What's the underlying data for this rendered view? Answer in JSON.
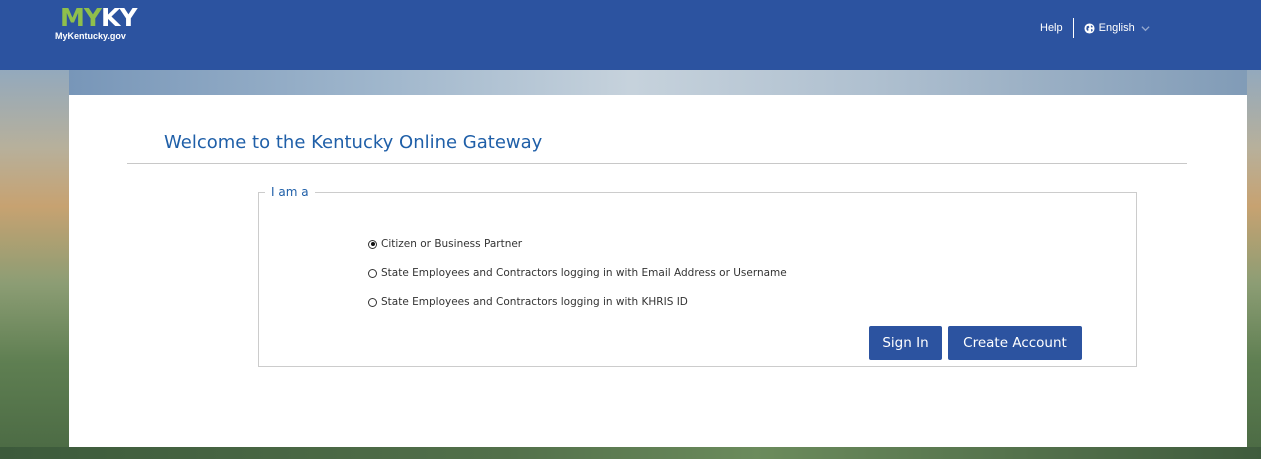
{
  "header": {
    "logo_text_my": "MY",
    "logo_text_ky": "KY",
    "logo_sub": "MyKentucky.gov",
    "help_label": "Help",
    "language_label": "English",
    "colors": {
      "bar": "#2c53a0",
      "logo_accent": "#8fbf4c"
    }
  },
  "main": {
    "title": "Welcome to the Kentucky Online Gateway",
    "role_legend": "I am a",
    "options": [
      {
        "label": "Citizen or Business Partner",
        "selected": true
      },
      {
        "label": "State Employees and Contractors logging in with Email Address or Username",
        "selected": false
      },
      {
        "label": "State Employees and Contractors logging in with KHRIS ID",
        "selected": false
      }
    ],
    "sign_in_label": "Sign In",
    "create_account_label": "Create Account"
  },
  "icons": {
    "language": "globe-icon",
    "dropdown": "chevron-down-icon"
  }
}
